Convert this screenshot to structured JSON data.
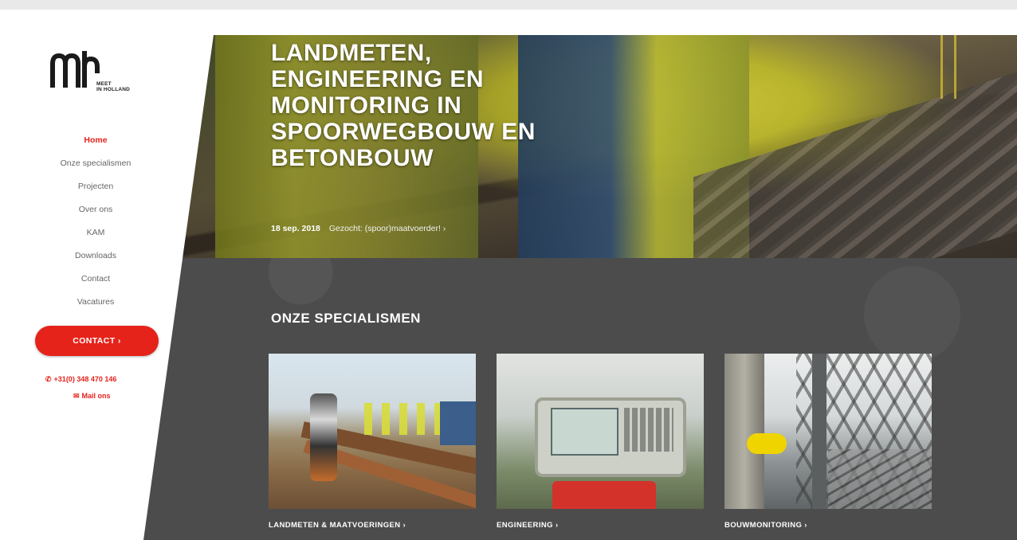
{
  "brand": {
    "logo_line1": "MEET",
    "logo_line2": "IN HOLLAND"
  },
  "nav": {
    "items": [
      {
        "label": "Home",
        "active": true
      },
      {
        "label": "Onze specialismen",
        "active": false
      },
      {
        "label": "Projecten",
        "active": false
      },
      {
        "label": "Over ons",
        "active": false
      },
      {
        "label": "KAM",
        "active": false
      },
      {
        "label": "Downloads",
        "active": false
      },
      {
        "label": "Contact",
        "active": false
      },
      {
        "label": "Vacatures",
        "active": false
      }
    ]
  },
  "sidebar": {
    "contact_button": "CONTACT ›",
    "phone": "+31(0) 348 470 146",
    "mail": "Mail ons"
  },
  "hero": {
    "title": "LANDMETEN, ENGINEERING EN MONITORING IN SPOORWEGBOUW EN BETONBOUW",
    "date": "18 sep. 2018",
    "link": "Gezocht: (spoor)maatvoerder! ›"
  },
  "specialisms": {
    "title": "ONZE SPECIALISMEN",
    "cards": [
      {
        "label": "LANDMETEN & MAATVOERINGEN ›"
      },
      {
        "label": "ENGINEERING ›"
      },
      {
        "label": "BOUWMONITORING ›"
      }
    ]
  },
  "colors": {
    "accent": "#e5231b",
    "section_bg": "#4c4c4c"
  }
}
